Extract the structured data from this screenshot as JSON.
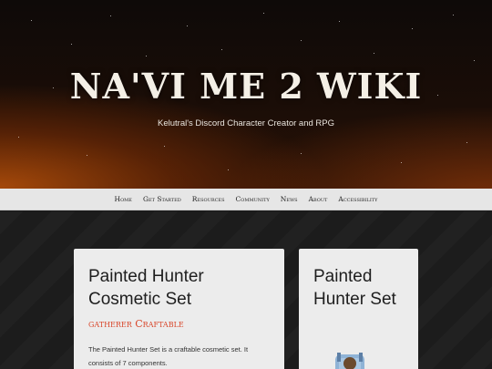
{
  "header": {
    "site_title": "NA'VI ME 2 WIKI",
    "tagline": "Kelutral's Discord Character Creator and RPG"
  },
  "nav": {
    "items": [
      "Home",
      "Get Started",
      "Resources",
      "Community",
      "News",
      "About",
      "Accessibility"
    ]
  },
  "main_card": {
    "title": "Painted Hunter Cosmetic Set",
    "tag": "gatherer Craftable",
    "body": "The Painted Hunter Set is a craftable cosmetic set. It consists of 7 components."
  },
  "side_card": {
    "title": "Painted Hunter Set",
    "image_icon": "painted-hunter-item-icon"
  },
  "colors": {
    "accent": "#d9462a",
    "nav_bg": "#e6e6e6",
    "card_bg": "#ececec"
  }
}
